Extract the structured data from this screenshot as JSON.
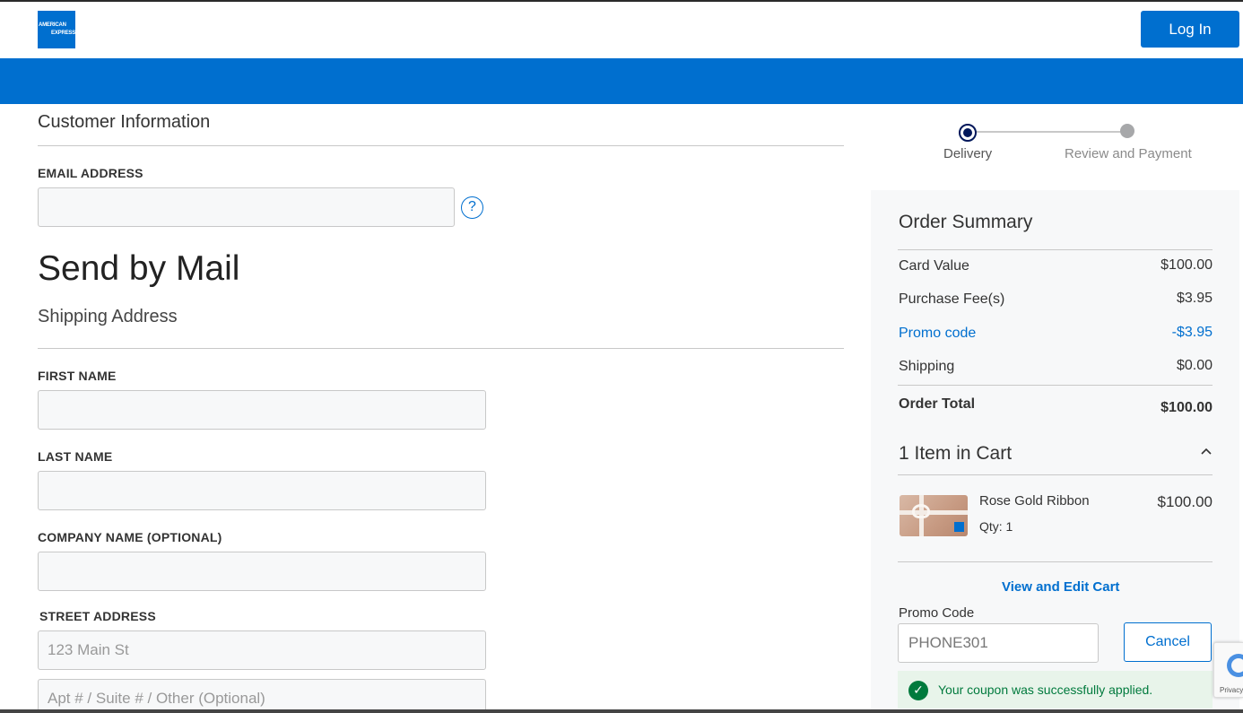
{
  "header": {
    "logo_line1": "AMERICAN",
    "logo_line2": "EXPRESS",
    "login_label": "Log In"
  },
  "customer": {
    "title": "Customer Information",
    "email_label": "EMAIL ADDRESS",
    "email_value": "",
    "help_icon": "?"
  },
  "delivery": {
    "title": "Send by Mail",
    "subtitle": "Shipping Address",
    "first_name_label": "FIRST NAME",
    "last_name_label": "LAST NAME",
    "company_label": "COMPANY NAME (OPTIONAL)",
    "street_label": "STREET ADDRESS",
    "street_placeholder": "123 Main St",
    "apt_placeholder": "Apt # / Suite # / Other (Optional)"
  },
  "stepper": {
    "steps": [
      {
        "label": "Delivery",
        "active": true
      },
      {
        "label": "Review and Payment",
        "active": false
      }
    ]
  },
  "summary": {
    "title": "Order Summary",
    "rows": [
      {
        "label": "Card Value",
        "value": "$100.00"
      },
      {
        "label": "Purchase Fee(s)",
        "value": "$3.95"
      },
      {
        "label": "Promo code",
        "value": "-$3.95"
      },
      {
        "label": "Shipping",
        "value": "$0.00"
      }
    ],
    "total_label": "Order Total",
    "total_value": "$100.00",
    "cart_title": "1 Item in Cart",
    "item": {
      "name": "Rose Gold Ribbon",
      "qty": "Qty: 1",
      "price": "$100.00"
    },
    "edit_link": "View and Edit Cart",
    "promo_label": "Promo Code",
    "promo_value": "PHONE301",
    "cancel_label": "Cancel",
    "success_message": "Your coupon was successfully applied."
  },
  "recaptcha": {
    "text": "Privacy"
  },
  "colors": {
    "brand_blue": "#006fcf",
    "success_green": "#007a3d",
    "step_active": "#00175a"
  }
}
